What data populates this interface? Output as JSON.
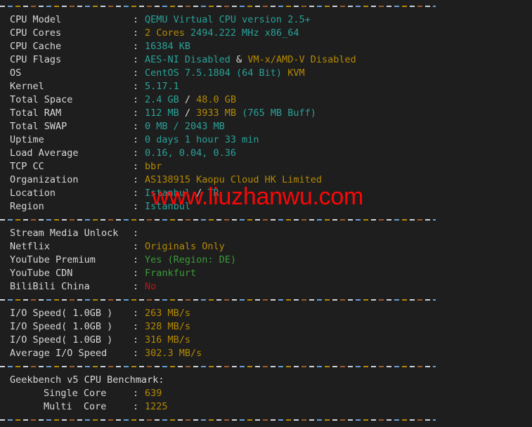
{
  "terminal": {
    "colon": ":",
    "colors": {
      "background": "#1e1e1e",
      "foreground": "#d8d8d8",
      "teal": "#2aa198",
      "yellow": "#b58900",
      "green": "#3c9b3c",
      "red": "#b01b1b",
      "watermark": "#fb0707"
    },
    "watermark": "www.liuzhanwu.com",
    "sections": [
      {
        "name": "system-info",
        "rows": [
          {
            "label": "CPU Model",
            "parts": [
              {
                "text": "QEMU Virtual CPU version 2.5+",
                "color": "teal"
              }
            ]
          },
          {
            "label": "CPU Cores",
            "parts": [
              {
                "text": "2 Cores",
                "color": "yellow"
              },
              {
                "text": " 2494.222 MHz x86_64",
                "color": "teal"
              }
            ]
          },
          {
            "label": "CPU Cache",
            "parts": [
              {
                "text": "16384 KB",
                "color": "teal"
              }
            ]
          },
          {
            "label": "CPU Flags",
            "parts": [
              {
                "text": "AES-NI Disabled",
                "color": "teal"
              },
              {
                "text": " & ",
                "color": "white"
              },
              {
                "text": "VM-x/AMD-V Disabled",
                "color": "yellow"
              }
            ]
          },
          {
            "label": "OS",
            "parts": [
              {
                "text": "CentOS 7.5.1804 (64 Bit) ",
                "color": "teal"
              },
              {
                "text": "KVM",
                "color": "yellow"
              }
            ]
          },
          {
            "label": "Kernel",
            "parts": [
              {
                "text": "5.17.1",
                "color": "teal"
              }
            ]
          },
          {
            "label": "Total Space",
            "parts": [
              {
                "text": "2.4 GB ",
                "color": "teal"
              },
              {
                "text": "/ ",
                "color": "white"
              },
              {
                "text": "48.0 GB",
                "color": "yellow"
              }
            ]
          },
          {
            "label": "Total RAM",
            "parts": [
              {
                "text": "112 MB ",
                "color": "teal"
              },
              {
                "text": "/ ",
                "color": "white"
              },
              {
                "text": "3933 MB ",
                "color": "yellow"
              },
              {
                "text": "(765 MB Buff)",
                "color": "teal"
              }
            ]
          },
          {
            "label": "Total SWAP",
            "parts": [
              {
                "text": "0 MB / 2043 MB",
                "color": "teal"
              }
            ]
          },
          {
            "label": "Uptime",
            "parts": [
              {
                "text": "0 days 1 hour 33 min",
                "color": "teal"
              }
            ]
          },
          {
            "label": "Load Average",
            "parts": [
              {
                "text": "0.16, 0.04, 0.36",
                "color": "teal"
              }
            ]
          },
          {
            "label": "TCP CC",
            "parts": [
              {
                "text": "bbr",
                "color": "yellow"
              }
            ]
          },
          {
            "label": "Organization",
            "parts": [
              {
                "text": "AS138915 Kaopu Cloud HK Limited",
                "color": "yellow"
              }
            ]
          },
          {
            "label": "Location",
            "parts": [
              {
                "text": "Istanbul ",
                "color": "teal"
              },
              {
                "text": "/ ",
                "color": "white"
              },
              {
                "text": "TR",
                "color": "teal"
              }
            ]
          },
          {
            "label": "Region",
            "parts": [
              {
                "text": "Istanbul",
                "color": "teal"
              }
            ]
          }
        ]
      },
      {
        "name": "stream-media-unlock",
        "rows": [
          {
            "label": "Stream Media Unlock",
            "parts": []
          },
          {
            "label": "Netflix",
            "parts": [
              {
                "text": "Originals Only",
                "color": "yellow"
              }
            ]
          },
          {
            "label": "YouTube Premium",
            "parts": [
              {
                "text": "Yes (Region: DE)",
                "color": "green"
              }
            ]
          },
          {
            "label": "YouTube CDN",
            "parts": [
              {
                "text": "Frankfurt",
                "color": "green"
              }
            ]
          },
          {
            "label": "BiliBili China",
            "parts": [
              {
                "text": "No",
                "color": "red"
              }
            ]
          }
        ]
      },
      {
        "name": "io-speed",
        "rows": [
          {
            "label": "I/O Speed( 1.0GB )",
            "parts": [
              {
                "text": "263 MB/s",
                "color": "yellow"
              }
            ]
          },
          {
            "label": "I/O Speed( 1.0GB )",
            "parts": [
              {
                "text": "328 MB/s",
                "color": "yellow"
              }
            ]
          },
          {
            "label": "I/O Speed( 1.0GB )",
            "parts": [
              {
                "text": "316 MB/s",
                "color": "yellow"
              }
            ]
          },
          {
            "label": "Average I/O Speed",
            "parts": [
              {
                "text": "302.3 MB/s",
                "color": "yellow"
              }
            ]
          }
        ]
      },
      {
        "name": "geekbench",
        "heading": "Geekbench v5 CPU Benchmark:",
        "rows": [
          {
            "label": "Single Core",
            "indent": true,
            "parts": [
              {
                "text": "639",
                "color": "yellow"
              }
            ]
          },
          {
            "label": "Multi  Core",
            "indent": true,
            "parts": [
              {
                "text": "1225",
                "color": "yellow"
              }
            ]
          }
        ]
      }
    ]
  }
}
